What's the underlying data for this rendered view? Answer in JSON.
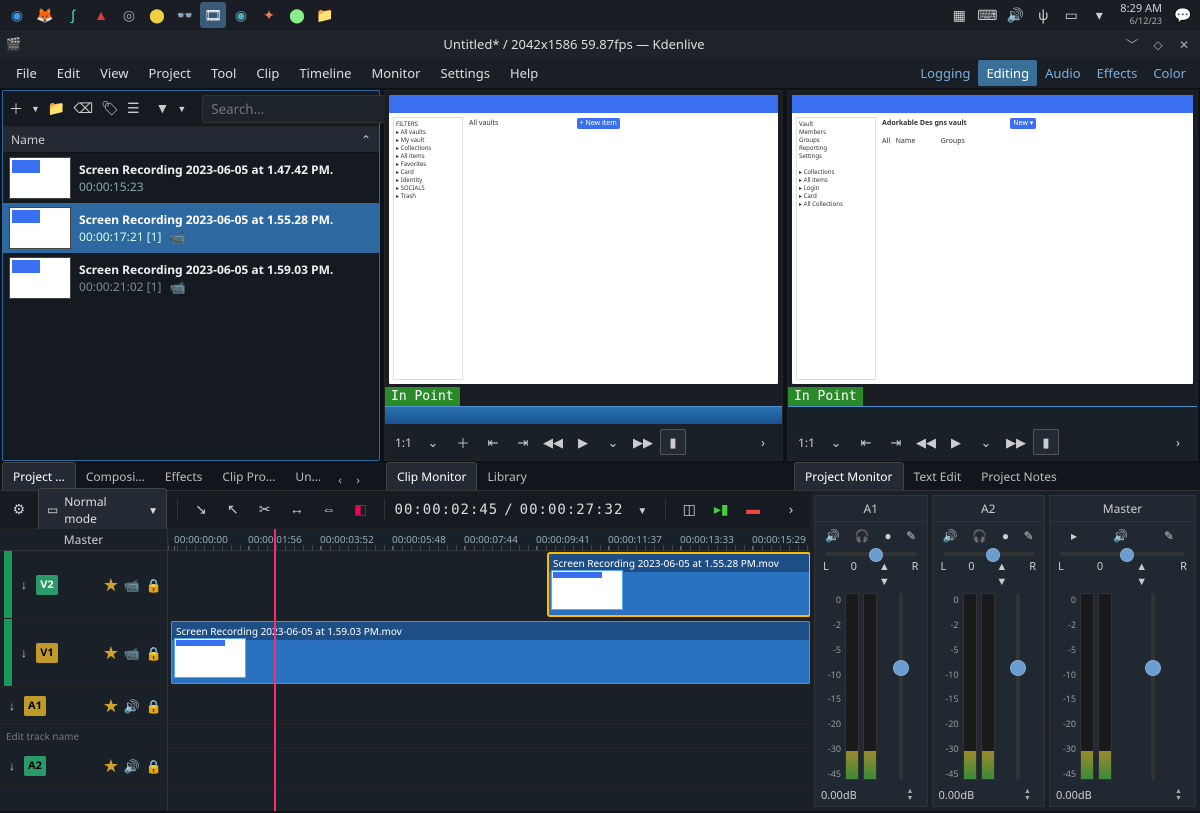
{
  "taskbar": {
    "clock_time": "8:29 AM",
    "clock_date": "6/12/23"
  },
  "window": {
    "title": "Untitled* / 2042x1586 59.87fps — Kdenlive"
  },
  "menubar": {
    "items": [
      "File",
      "Edit",
      "View",
      "Project",
      "Tool",
      "Clip",
      "Timeline",
      "Monitor",
      "Settings",
      "Help"
    ],
    "modes": [
      "Logging",
      "Editing",
      "Audio",
      "Effects",
      "Color"
    ],
    "active_mode": "Editing"
  },
  "bin": {
    "search_placeholder": "Search...",
    "header_name": "Name",
    "clips": [
      {
        "title": "Screen Recording 2023-06-05 at 1.47.42 PM.",
        "duration": "00:00:15:23",
        "selected": false,
        "usage": ""
      },
      {
        "title": "Screen Recording 2023-06-05 at 1.55.28 PM.",
        "duration": "00:00:17:21 [1]",
        "selected": true,
        "usage": "📹"
      },
      {
        "title": "Screen Recording 2023-06-05 at 1.59.03 PM.",
        "duration": "00:00:21:02 [1]",
        "selected": false,
        "usage": "📹"
      }
    ]
  },
  "clip_monitor": {
    "in_point_label": "In Point",
    "zoom": "1:1"
  },
  "project_monitor": {
    "in_point_label": "In Point",
    "zoom": "1:1",
    "preview_heading": "Adorkable Des gns vault"
  },
  "dock_tabs": {
    "left": [
      "Project …",
      "Composi…",
      "Effects",
      "Clip Pro…",
      "Un…"
    ],
    "mid": [
      "Clip Monitor",
      "Library"
    ],
    "right": [
      "Project Monitor",
      "Text Edit",
      "Project Notes"
    ]
  },
  "timeline": {
    "mode_label": "Normal mode",
    "position_tc": "00:00:02:45",
    "duration_tc": "00:00:27:32",
    "master_label": "Master",
    "ruler_ticks": [
      "00:00:00:00",
      "00:00:01:56",
      "00:00:03:52",
      "00:00:05:48",
      "00:00:07:44",
      "00:00:09:41",
      "00:00:11:37",
      "00:00:13:33",
      "00:00:15:29"
    ],
    "tracks": {
      "v2": "V2",
      "v1": "V1",
      "a1": "A1",
      "a2": "A2"
    },
    "edit_track_placeholder": "Edit track name",
    "clips": {
      "v2_clip": "Screen Recording 2023-06-05 at 1.55.28 PM.mov",
      "v1_clip": "Screen Recording 2023-06-05 at 1.59.03 PM.mov"
    }
  },
  "mixer": {
    "strips": [
      "A1",
      "A2",
      "Master"
    ],
    "pan_l": "L",
    "pan_val": "0",
    "pan_r": "R",
    "scale": [
      "0",
      "-2",
      "-5",
      "-10",
      "-15",
      "-20",
      "-30",
      "-45"
    ],
    "db_label": "0.00dB"
  }
}
